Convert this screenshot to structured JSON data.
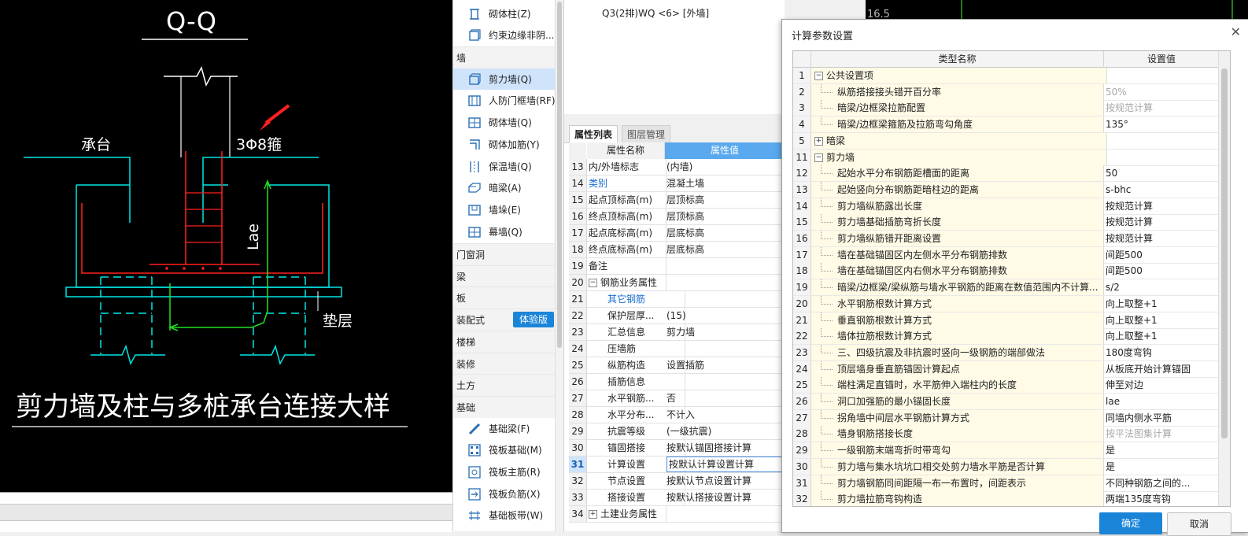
{
  "cad": {
    "title": "Q-Q",
    "label_chengtai": "承台",
    "label_rebar": "3Φ8箍",
    "label_lae": "Lae",
    "label_dianceng": "垫层",
    "caption": "剪力墙及柱与多桩承台连接大样"
  },
  "strip": {
    "text": "16.5"
  },
  "tree": {
    "items": [
      {
        "label": "砌体柱(Z)",
        "icon": "column-icon"
      },
      {
        "label": "约束边缘非阴...",
        "icon": "edge-icon"
      }
    ],
    "cat_wall": "墙",
    "wall_items": [
      {
        "label": "剪力墙(Q)",
        "icon": "shear-wall-icon"
      },
      {
        "label": "人防门框墙(RF)",
        "icon": "door-frame-wall-icon"
      },
      {
        "label": "砌体墙(Q)",
        "icon": "masonry-wall-icon"
      },
      {
        "label": "砌体加筋(Y)",
        "icon": "masonry-rebar-icon"
      },
      {
        "label": "保温墙(Q)",
        "icon": "insulation-wall-icon"
      },
      {
        "label": "暗梁(A)",
        "icon": "hidden-beam-icon"
      },
      {
        "label": "墙垛(E)",
        "icon": "pier-icon"
      },
      {
        "label": "幕墙(Q)",
        "icon": "curtain-wall-icon"
      }
    ],
    "cats": [
      "门窗洞",
      "梁",
      "板",
      "装配式",
      "楼梯",
      "装修",
      "土方",
      "基础"
    ],
    "badge": "体验版",
    "found_items": [
      {
        "label": "基础梁(F)",
        "icon": "foundation-beam-icon"
      },
      {
        "label": "筏板基础(M)",
        "icon": "raft-icon"
      },
      {
        "label": "筏板主筋(R)",
        "icon": "raft-main-rebar-icon"
      },
      {
        "label": "筏板负筋(X)",
        "icon": "raft-neg-rebar-icon"
      },
      {
        "label": "基础板带(W)",
        "icon": "strip-icon"
      }
    ]
  },
  "mid": {
    "top_text": "Q3(2排)WQ <6> [外墙]",
    "tab_props": "属性列表",
    "tab_layers": "图层管理",
    "col_name": "属性名称",
    "col_value": "属性值",
    "rows": [
      {
        "n": "13",
        "name": "内/外墙标志",
        "value": "(内墙)"
      },
      {
        "n": "14",
        "name": "类别",
        "value": "混凝土墙",
        "blue": true
      },
      {
        "n": "15",
        "name": "起点顶标高(m)",
        "value": "层顶标高"
      },
      {
        "n": "16",
        "name": "终点顶标高(m)",
        "value": "层顶标高"
      },
      {
        "n": "17",
        "name": "起点底标高(m)",
        "value": "层底标高"
      },
      {
        "n": "18",
        "name": "终点底标高(m)",
        "value": "层底标高"
      },
      {
        "n": "19",
        "name": "备注",
        "value": ""
      },
      {
        "n": "20",
        "name": "钢筋业务属性",
        "value": "",
        "pm": "−"
      },
      {
        "n": "21",
        "name": "其它钢筋",
        "value": "",
        "blue": true,
        "indent": true
      },
      {
        "n": "22",
        "name": "保护层厚...",
        "value": "(15)",
        "indent": true
      },
      {
        "n": "23",
        "name": "汇总信息",
        "value": "剪力墙",
        "indent": true
      },
      {
        "n": "24",
        "name": "压墙筋",
        "value": "",
        "indent": true
      },
      {
        "n": "25",
        "name": "纵筋构造",
        "value": "设置插筋",
        "indent": true
      },
      {
        "n": "26",
        "name": "插筋信息",
        "value": "",
        "indent": true
      },
      {
        "n": "27",
        "name": "水平钢筋...",
        "value": "否",
        "indent": true
      },
      {
        "n": "28",
        "name": "水平分布...",
        "value": "不计入",
        "indent": true
      },
      {
        "n": "29",
        "name": "抗震等级",
        "value": "(一级抗震)",
        "indent": true
      },
      {
        "n": "30",
        "name": "锚固搭接",
        "value": "按默认锚固搭接计算",
        "indent": true
      },
      {
        "n": "31",
        "name": "计算设置",
        "value": "按默认计算设置计算",
        "indent": true,
        "sel": true
      },
      {
        "n": "32",
        "name": "节点设置",
        "value": "按默认节点设置计算",
        "indent": true
      },
      {
        "n": "33",
        "name": "搭接设置",
        "value": "按默认搭接设置计算",
        "indent": true
      },
      {
        "n": "34",
        "name": "土建业务属性",
        "value": "",
        "pm": "+"
      }
    ]
  },
  "dialog": {
    "title": "计算参数设置",
    "col_name": "类型名称",
    "col_value": "设置值",
    "ok": "确定",
    "cancel": "取消",
    "rows": [
      {
        "n": "1",
        "name": "公共设置项",
        "value": "",
        "pm": "−"
      },
      {
        "n": "2",
        "name": "纵筋搭接接头错开百分率",
        "value": "50%",
        "gray": true,
        "child": true
      },
      {
        "n": "3",
        "name": "暗梁/边框梁拉筋配置",
        "value": "按规范计算",
        "gray": true,
        "child": true
      },
      {
        "n": "4",
        "name": "暗梁/边框梁箍筋及拉筋弯勾角度",
        "value": "135°",
        "child": true
      },
      {
        "n": "5",
        "name": "暗梁",
        "value": "",
        "pm": "+"
      },
      {
        "n": "11",
        "name": "剪力墙",
        "value": "",
        "pm": "−"
      },
      {
        "n": "12",
        "name": "起始水平分布钢筋距槽面的距离",
        "value": "50",
        "child": true
      },
      {
        "n": "13",
        "name": "起始竖向分布钢筋距暗柱边的距离",
        "value": "s-bhc",
        "child": true
      },
      {
        "n": "14",
        "name": "剪力墙纵筋露出长度",
        "value": "按规范计算",
        "child": true
      },
      {
        "n": "15",
        "name": "剪力墙基础插筋弯折长度",
        "value": "按规范计算",
        "child": true
      },
      {
        "n": "16",
        "name": "剪力墙纵筋错开距离设置",
        "value": "按规范计算",
        "child": true
      },
      {
        "n": "17",
        "name": "墙在基础锚固区内左侧水平分布钢筋排数",
        "value": "间距500",
        "child": true
      },
      {
        "n": "18",
        "name": "墙在基础锚固区内右侧水平分布钢筋排数",
        "value": "间距500",
        "child": true
      },
      {
        "n": "19",
        "name": "暗梁/边框梁/梁纵筋与墙水平钢筋的距离在数值范围内不计算...",
        "value": "s/2",
        "child": true
      },
      {
        "n": "20",
        "name": "水平钢筋根数计算方式",
        "value": "向上取整+1",
        "child": true
      },
      {
        "n": "21",
        "name": "垂直钢筋根数计算方式",
        "value": "向上取整+1",
        "child": true
      },
      {
        "n": "22",
        "name": "墙体拉筋根数计算方式",
        "value": "向上取整+1",
        "child": true
      },
      {
        "n": "23",
        "name": "三、四级抗震及非抗震时竖向一级钢筋的端部做法",
        "value": "180度弯钩",
        "child": true
      },
      {
        "n": "24",
        "name": "顶层墙身垂直筋锚固计算起点",
        "value": "从板底开始计算锚固",
        "child": true
      },
      {
        "n": "25",
        "name": "端柱满足直锚时，水平筋伸入端柱内的长度",
        "value": "伸至对边",
        "child": true
      },
      {
        "n": "26",
        "name": "洞口加强筋的最小锚固长度",
        "value": "lae",
        "child": true
      },
      {
        "n": "27",
        "name": "拐角墙中间层水平钢筋计算方式",
        "value": "同墙内侧水平筋",
        "child": true
      },
      {
        "n": "28",
        "name": "墙身钢筋搭接长度",
        "value": "按平法图集计算",
        "gray": true,
        "child": true
      },
      {
        "n": "29",
        "name": "一级钢筋末端弯折时带弯勾",
        "value": "是",
        "child": true
      },
      {
        "n": "30",
        "name": "剪力墙与集水坑坑口相交处剪力墙水平筋是否计算",
        "value": "是",
        "child": true
      },
      {
        "n": "31",
        "name": "剪力墙钢筋同间距隔一布一布置时，间距表示",
        "value": "不同种钢筋之间的...",
        "child": true
      },
      {
        "n": "32",
        "name": "剪力墙拉筋弯钩构造",
        "value": "两端135度弯钩",
        "child": true
      }
    ]
  },
  "colors": {
    "accent": "#1a84d8",
    "cad_bg": "#000000",
    "cyan": "#00ffff",
    "red": "#ff2020",
    "green": "#22dd22"
  }
}
